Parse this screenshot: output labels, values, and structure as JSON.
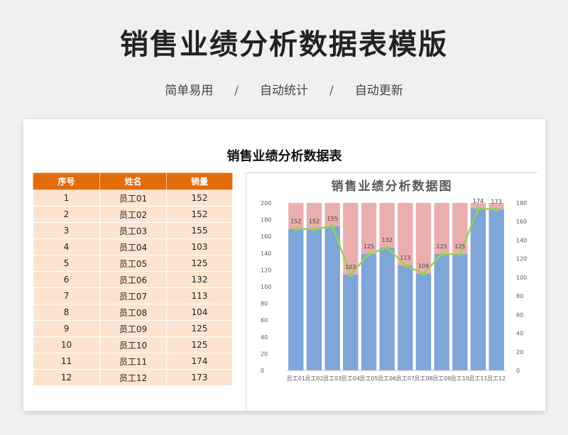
{
  "header": {
    "title": "销售业绩分析数据表模版",
    "tags": [
      "简单易用",
      "自动统计",
      "自动更新"
    ],
    "separator": "/"
  },
  "card": {
    "title": "销售业绩分析数据表"
  },
  "table": {
    "headers": [
      "序号",
      "姓名",
      "销量"
    ],
    "rows": [
      [
        "1",
        "员工01",
        "152"
      ],
      [
        "2",
        "员工02",
        "152"
      ],
      [
        "3",
        "员工03",
        "155"
      ],
      [
        "4",
        "员工04",
        "103"
      ],
      [
        "5",
        "员工05",
        "125"
      ],
      [
        "6",
        "员工06",
        "132"
      ],
      [
        "7",
        "员工07",
        "113"
      ],
      [
        "8",
        "员工08",
        "104"
      ],
      [
        "9",
        "员工09",
        "125"
      ],
      [
        "10",
        "员工10",
        "125"
      ],
      [
        "11",
        "员工11",
        "174"
      ],
      [
        "12",
        "员工12",
        "173"
      ]
    ]
  },
  "chart_data": {
    "type": "bar",
    "title": "销售业绩分析数据图",
    "categories": [
      "员工01",
      "员工02",
      "员工03",
      "员工04",
      "员工05",
      "员工06",
      "员工07",
      "员工08",
      "员工09",
      "员工10",
      "员工11",
      "员工12"
    ],
    "series": [
      {
        "values": [
          152,
          152,
          155,
          103,
          125,
          132,
          113,
          104,
          125,
          125,
          174,
          173
        ],
        "axis": "right",
        "chart": "bar",
        "color": "#7ea6d8"
      },
      {
        "values": [
          200,
          200,
          200,
          200,
          200,
          200,
          200,
          200,
          200,
          200,
          200,
          200
        ],
        "axis": "left",
        "chart": "bar",
        "color": "#e8a0a0"
      },
      {
        "values": [
          152,
          152,
          155,
          103,
          125,
          132,
          113,
          104,
          125,
          125,
          174,
          173
        ],
        "axis": "right",
        "chart": "line",
        "color": "#9bcf53"
      }
    ],
    "ylim_left": [
      0,
      200
    ],
    "yticks_left": [
      0,
      20,
      40,
      60,
      80,
      100,
      120,
      140,
      160,
      180,
      200
    ],
    "ylim_right": [
      0,
      180
    ],
    "yticks_right": [
      0,
      20,
      40,
      60,
      80,
      100,
      120,
      140,
      160,
      180
    ],
    "data_labels": true,
    "grid": false,
    "legend": false
  }
}
